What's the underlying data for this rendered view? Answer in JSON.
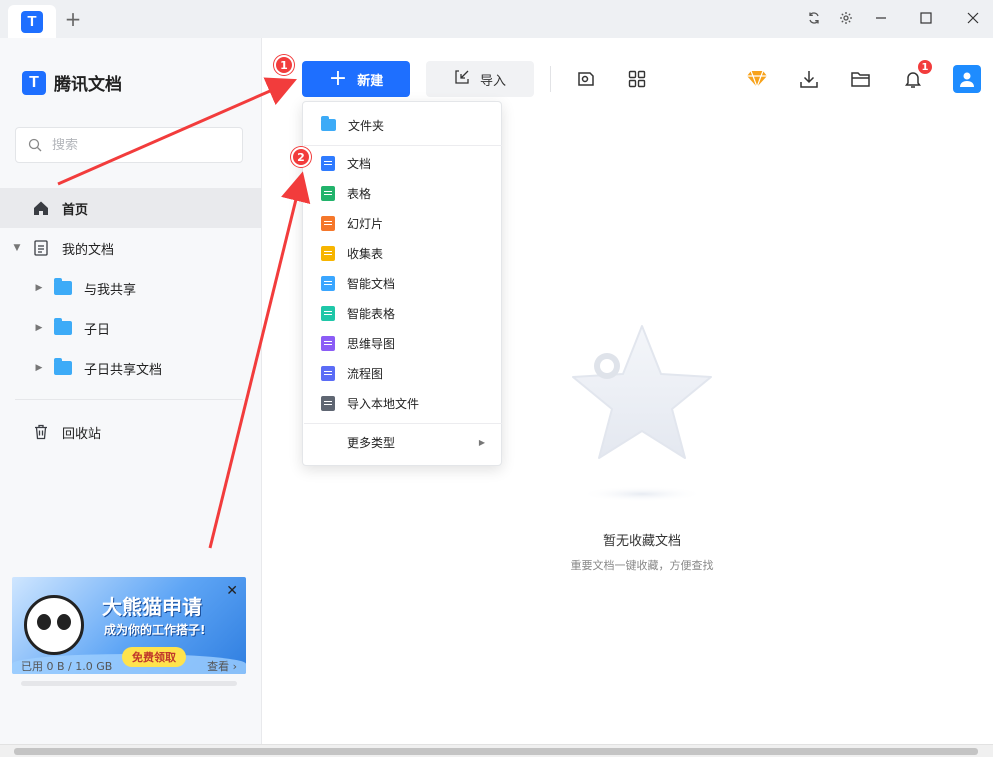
{
  "titlebar": {
    "add_tab": "+"
  },
  "app": {
    "logo_glyph": "T",
    "name": "腾讯文档"
  },
  "search": {
    "placeholder": "搜索"
  },
  "nav": {
    "home": "首页",
    "my_docs": "我的文档",
    "folders": [
      "与我共享",
      "子日",
      "子日共享文档"
    ],
    "trash": "回收站"
  },
  "promo": {
    "title": "大熊猫申请",
    "subtitle": "成为你的工作搭子!",
    "cta": "免费领取"
  },
  "storage": {
    "used": "已用 0 B / 1.0 GB",
    "view": "查看 ›",
    "used_fraction": 0
  },
  "toolbar": {
    "new_label": "新建",
    "import_label": "导入",
    "notification_count": "1"
  },
  "menu": {
    "items": [
      {
        "label": "文件夹",
        "color": "#3dabf7"
      },
      {
        "label": "文档",
        "color": "#2f7bff"
      },
      {
        "label": "表格",
        "color": "#22b36b"
      },
      {
        "label": "幻灯片",
        "color": "#f5772b"
      },
      {
        "label": "收集表",
        "color": "#f7b500"
      },
      {
        "label": "智能文档",
        "color": "#3aa6ff"
      },
      {
        "label": "智能表格",
        "color": "#1fc7a8"
      },
      {
        "label": "思维导图",
        "color": "#8b5cf6"
      },
      {
        "label": "流程图",
        "color": "#5b6cf6"
      },
      {
        "label": "导入本地文件",
        "color": "#5f6672"
      }
    ],
    "more": "更多类型"
  },
  "empty": {
    "title": "暂无收藏文档",
    "subtitle": "重要文档一键收藏，方便查找"
  },
  "annotations": {
    "step1": "1",
    "step2": "2"
  },
  "colors": {
    "accent": "#1e6fff",
    "arrow": "#f23c3c"
  }
}
